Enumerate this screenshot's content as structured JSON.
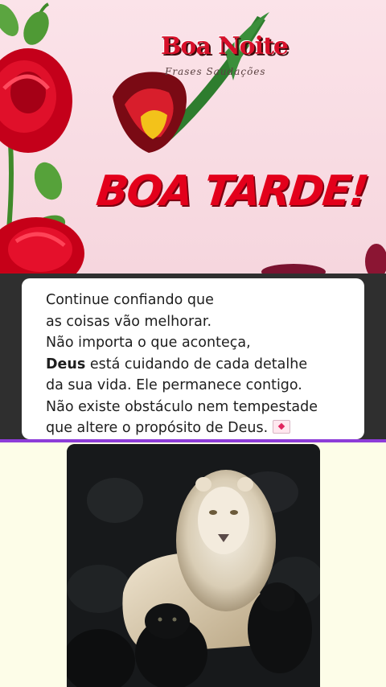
{
  "greeting_card": {
    "logo_title": "Boa Noite",
    "logo_subtitle": "Frases Saudações",
    "headline": "BOA TARDE!"
  },
  "message": {
    "line1": "Continue confiando que",
    "line2": "as coisas vão melhorar.",
    "line3": "Não importa o que aconteça,",
    "line4_bold": "Deus",
    "line4_rest": " está cuidando de cada detalhe",
    "line5": "da sua vida. Ele permanece contigo.",
    "line6": "Não existe obstáculo nem tempestade",
    "line7": "que altere o propósito de Deus. ",
    "emoji": "love-letter-icon"
  },
  "photo": {
    "subject": "white-lion-with-black-panthers-icon"
  },
  "colors": {
    "headline_red": "#e3001b",
    "divider_purple": "#8d3cd8",
    "page_background": "#fdfde8"
  }
}
